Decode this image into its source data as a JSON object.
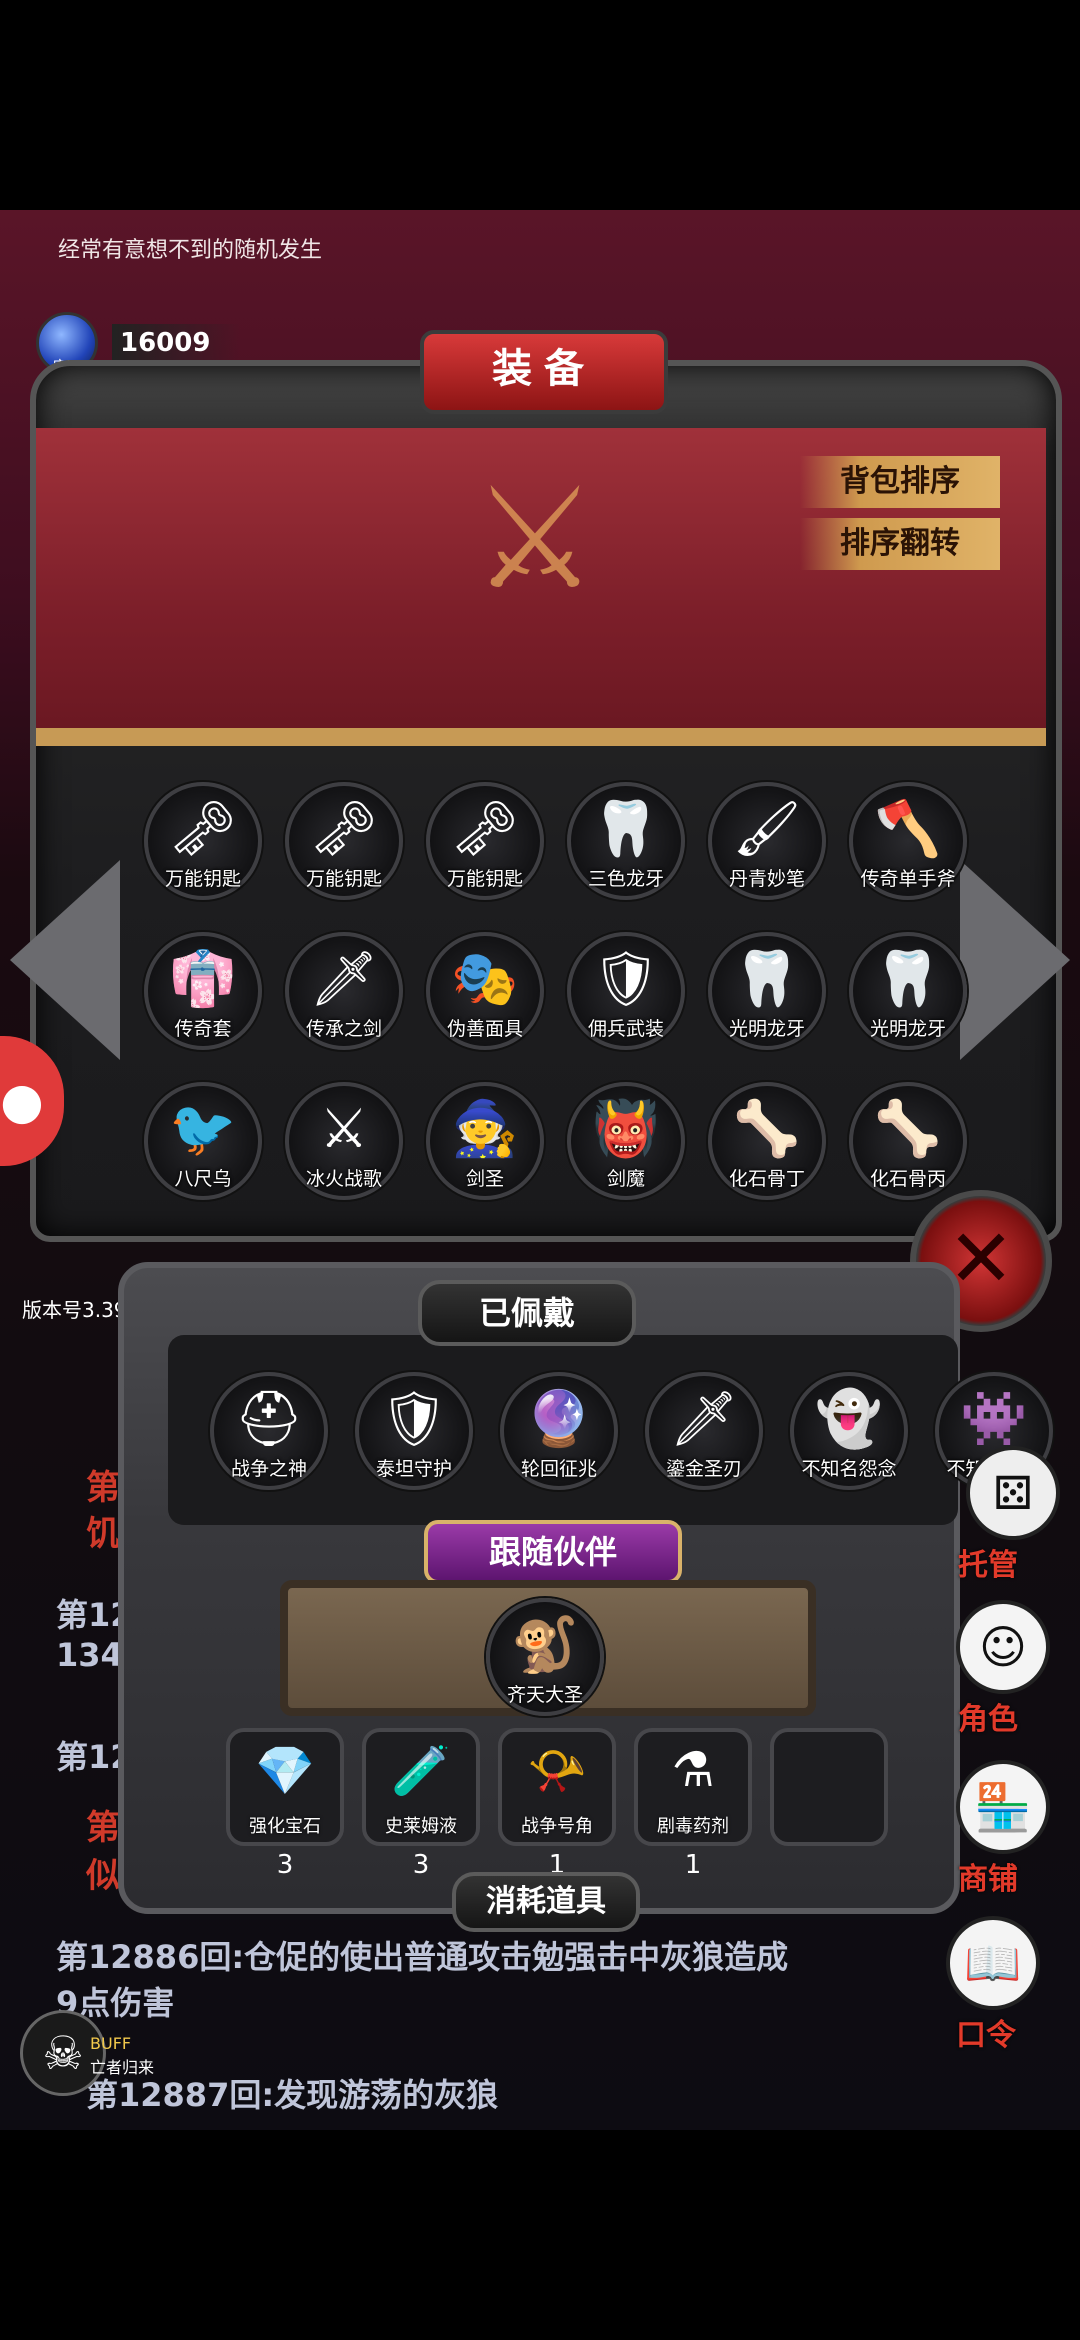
{
  "tip_text": "经常有意想不到的随机发生",
  "currency": {
    "label": "宝石",
    "amount": "16009",
    "icon": "blue-gem-icon"
  },
  "panel_title": "装备",
  "buttons": {
    "sort_bag": "背包排序",
    "sort_reverse": "排序翻转"
  },
  "inventory": [
    {
      "label": "万能钥匙",
      "icon": "key-icon"
    },
    {
      "label": "万能钥匙",
      "icon": "key-icon"
    },
    {
      "label": "万能钥匙",
      "icon": "key-icon"
    },
    {
      "label": "三色龙牙",
      "icon": "dragon-tooth-icon"
    },
    {
      "label": "丹青妙笔",
      "icon": "brush-icon"
    },
    {
      "label": "传奇单手斧",
      "icon": "axe-icon"
    },
    {
      "label": "传奇套",
      "icon": "robe-icon"
    },
    {
      "label": "传承之剑",
      "icon": "sword-icon"
    },
    {
      "label": "伪善面具",
      "icon": "mask-icon"
    },
    {
      "label": "佣兵武装",
      "icon": "armor-icon"
    },
    {
      "label": "光明龙牙",
      "icon": "dragon-tooth-icon"
    },
    {
      "label": "光明龙牙",
      "icon": "dragon-tooth-icon"
    },
    {
      "label": "八尺乌",
      "icon": "crow-icon"
    },
    {
      "label": "冰火战歌",
      "icon": "dual-sword-icon"
    },
    {
      "label": "剑圣",
      "icon": "swordmaster-icon"
    },
    {
      "label": "剑魔",
      "icon": "demon-icon"
    },
    {
      "label": "化石骨丁",
      "icon": "bone-icon"
    },
    {
      "label": "化石骨丙",
      "icon": "bone-icon"
    }
  ],
  "version": "版本号3.39",
  "worn": {
    "title": "已佩戴",
    "items": [
      {
        "label": "战争之神",
        "icon": "war-helmet-icon"
      },
      {
        "label": "泰坦守护",
        "icon": "titan-armor-icon"
      },
      {
        "label": "轮回征兆",
        "icon": "crystal-staff-icon"
      },
      {
        "label": "鎏金圣刃",
        "icon": "golden-sword-icon"
      },
      {
        "label": "不知名怨念",
        "icon": "ghost-icon"
      },
      {
        "label": "不知名恶念",
        "icon": "spirit-icon"
      }
    ]
  },
  "companion": {
    "title": "跟随伙伴",
    "label": "齐天大圣",
    "icon": "monkey-king-icon"
  },
  "consumables": {
    "title": "消耗道具",
    "items": [
      {
        "label": "强化宝石",
        "count": "3",
        "icon": "green-gem-icon"
      },
      {
        "label": "史莱姆液",
        "count": "3",
        "icon": "potion-icon"
      },
      {
        "label": "战争号角",
        "count": "1",
        "icon": "horn-icon"
      },
      {
        "label": "剧毒药剂",
        "count": "1",
        "icon": "poison-icon"
      }
    ]
  },
  "log": {
    "l1": "第12",
    "l1b": "134",
    "l2": "第12",
    "l3": "第12886回:仓促的使出普通攻击勉强击中灰狼造成",
    "l3b": "9点伤害",
    "l4": "第12887回:发现游荡的灰狼",
    "red1": "第",
    "red1b": "饥",
    "red2": "第",
    "red2b": "似"
  },
  "side_buttons": {
    "manage": "托管",
    "role": "角色",
    "shop": "商铺",
    "code": "口令"
  },
  "buff": {
    "label": "BUFF",
    "name": "亡者归来"
  },
  "colors": {
    "accent_red": "#e23a2a",
    "banner": "#8d2330",
    "gold": "#d9a35a"
  }
}
